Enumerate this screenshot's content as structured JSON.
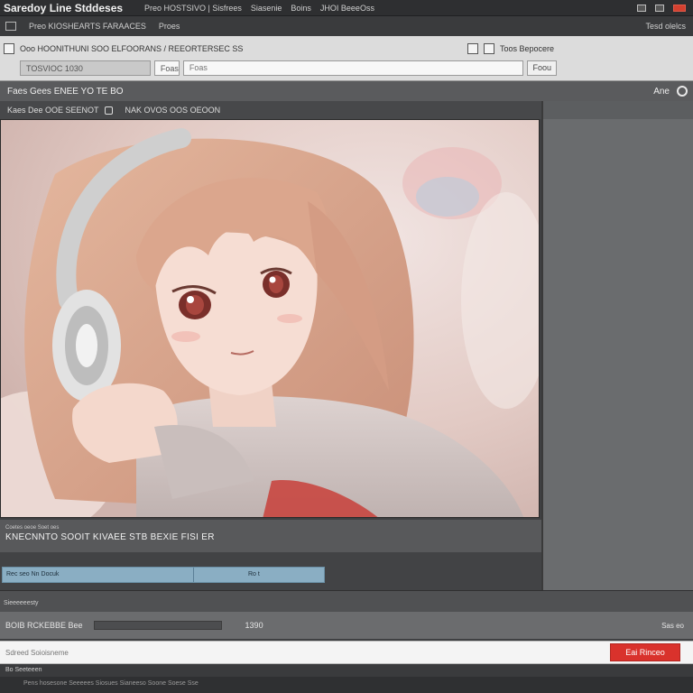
{
  "window": {
    "title": "Saredoy Line Stddeses",
    "menu": [
      "Preo HOSTSIVO | Sisfrees",
      "Siasenie",
      "Boins",
      "JHOI BeeeOss"
    ],
    "window_controls": [
      "min",
      "max",
      "close"
    ]
  },
  "menubar": {
    "left": [
      "Preo KIOSHEARTS FARAACES",
      "Proes"
    ],
    "right": "Tesd olelcs"
  },
  "toolbar": {
    "path": "Ooo HOONITHUNI SOO ELFOORANS / REEORTERSEC SS",
    "right_label": "Toos Bepocere",
    "field1_value": "TOSVIOC 1030",
    "field2_value": "Foas",
    "field3_placeholder": "Foas",
    "go_label": "Foou"
  },
  "subbar": {
    "left": "Faes Gees  ENEE YO  TE BO",
    "right": "Ane"
  },
  "panel": {
    "tab1": "Kaes Dee OOE SEENOT",
    "tab2": "NAK OVOS OOS OEOON"
  },
  "preview": {
    "subject": "anime girl with headphones",
    "colors": {
      "background": "#e8d3cf",
      "hair": "#d9a98f",
      "skin": "#f5dcd2",
      "headphones": "#d8d8d8",
      "sweater": "#cfc4c2",
      "accent": "#c8403a"
    }
  },
  "info": {
    "small": "Coetes oeoe  Soet oes",
    "big": "KNECNNTO SOOIT KIVAEE STB BEXIE FISI ER"
  },
  "progress": {
    "seg1": "Rec seo   Nn  Docuk",
    "seg2": "Ro  t"
  },
  "strip1": "Sieeeeeesty",
  "strip2": {
    "label": "BOIB RCKEBBE  Bee",
    "value": "1390",
    "right": "Sas eo"
  },
  "input": {
    "placeholder": "Sdreed Soioisneme",
    "action_label": "Eai Rinceo"
  },
  "footer": {
    "line1": "Bo  Seeteeen",
    "line2": "Pens hosesone  Seeeees  Siosues  Sianeeso  Soone  Soese Sse"
  },
  "colors": {
    "accent_red": "#d9322c",
    "progress_blue": "#8aaec3",
    "chrome_dark": "#3f4042"
  }
}
